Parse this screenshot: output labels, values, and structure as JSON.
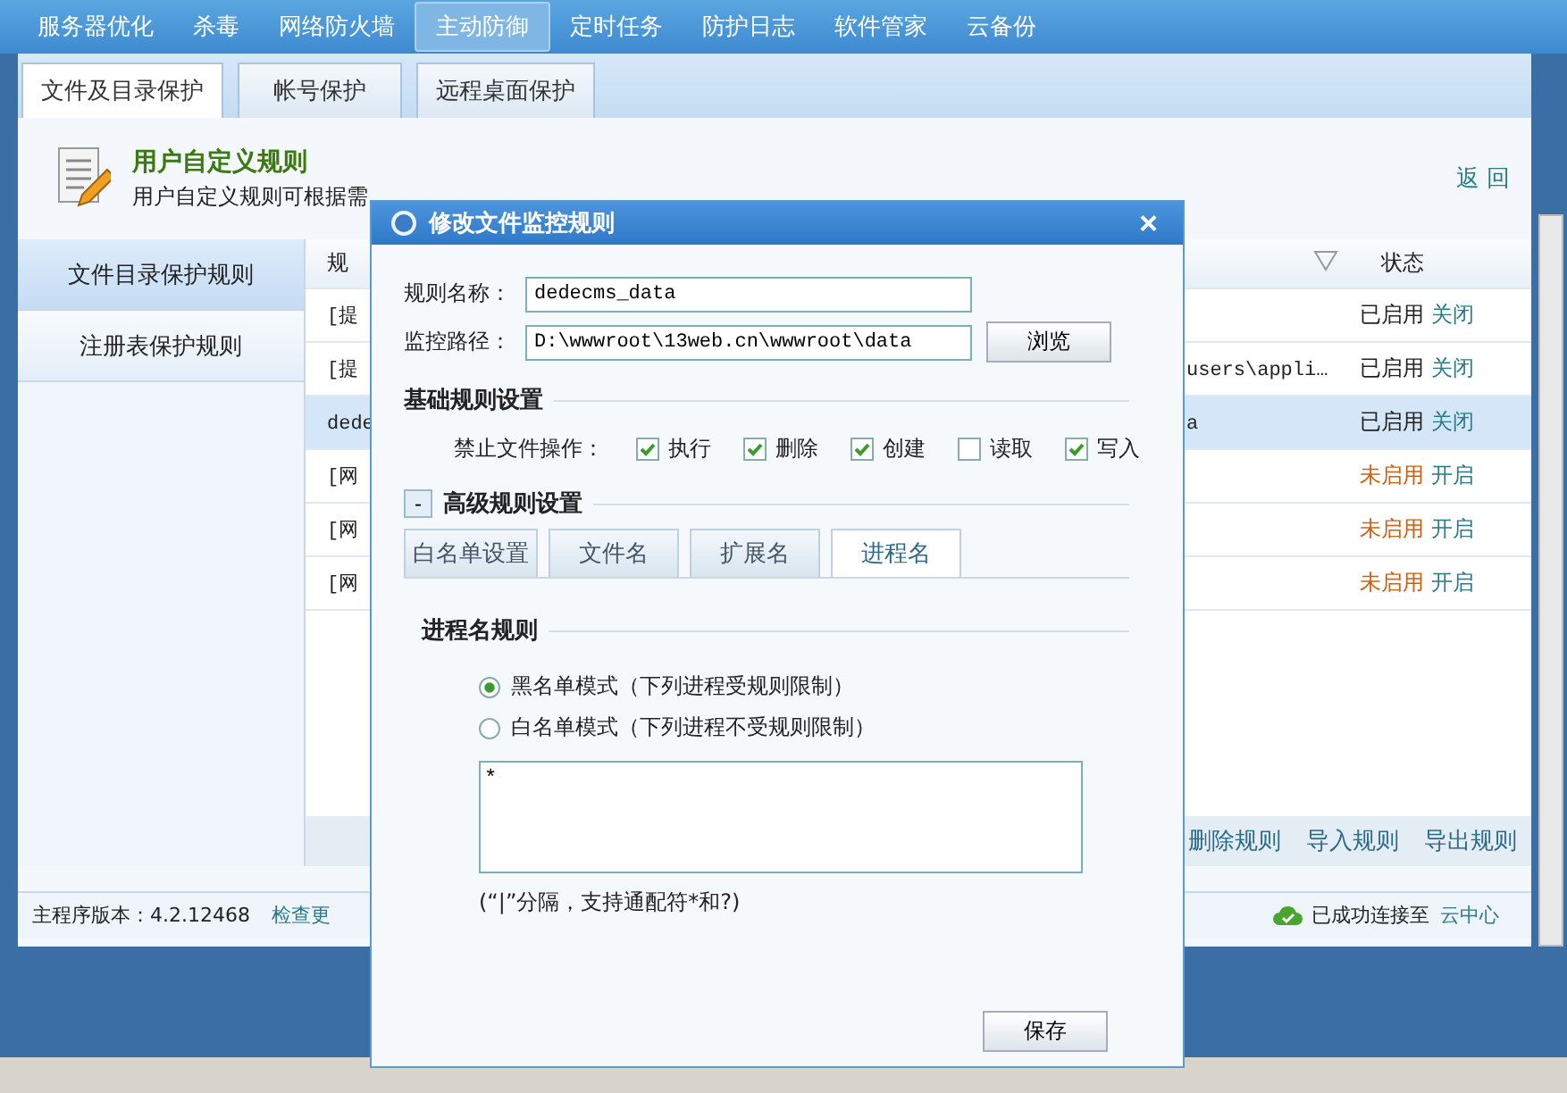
{
  "nav": [
    {
      "label": "服务器优化",
      "selected": false
    },
    {
      "label": "杀毒",
      "selected": false
    },
    {
      "label": "网络防火墙",
      "selected": false
    },
    {
      "label": "主动防御",
      "selected": true
    },
    {
      "label": "定时任务",
      "selected": false
    },
    {
      "label": "防护日志",
      "selected": false
    },
    {
      "label": "软件管家",
      "selected": false
    },
    {
      "label": "云备份",
      "selected": false
    }
  ],
  "subtabs": [
    {
      "label": "文件及目录保护",
      "selected": true
    },
    {
      "label": "帐号保护",
      "selected": false
    },
    {
      "label": "远程桌面保护",
      "selected": false
    }
  ],
  "header": {
    "title": "用户自定义规则",
    "description": "用户自定义规则可根据需",
    "back": "返 回"
  },
  "sidebar": [
    {
      "label": "文件目录保护规则",
      "selected": true
    },
    {
      "label": "注册表保护规则",
      "selected": false
    }
  ],
  "table": {
    "columns": [
      "规",
      "状态"
    ],
    "rows": [
      {
        "column_1": "[提",
        "column_2": "",
        "status": "已启用",
        "enabled": true,
        "action": "关闭",
        "selected": false
      },
      {
        "column_1": "[提",
        "column_2": "users\\appli…",
        "status": "已启用",
        "enabled": true,
        "action": "关闭",
        "selected": false
      },
      {
        "column_1": "dede",
        "column_2": "a",
        "status": "已启用",
        "enabled": true,
        "action": "关闭",
        "selected": true
      },
      {
        "column_1": "[网",
        "column_2": "",
        "status": "未启用",
        "enabled": false,
        "action": "开启",
        "selected": false
      },
      {
        "column_1": "[网",
        "column_2": "",
        "status": "未启用",
        "enabled": false,
        "action": "开启",
        "selected": false
      },
      {
        "column_1": "[网",
        "column_2": "",
        "status": "未启用",
        "enabled": false,
        "action": "开启",
        "selected": false
      }
    ]
  },
  "toolbar": [
    "删除规则",
    "导入规则",
    "导出规则"
  ],
  "status_bar": {
    "version": "主程序版本：4.2.12468",
    "update": "检查更",
    "connected": "已成功连接至",
    "cloud": "云中心"
  },
  "dialog": {
    "title": "修改文件监控规则",
    "close": "×",
    "fields": [
      {
        "label": "规则名称：",
        "value": "dedecms_data"
      },
      {
        "label": "监控路径：",
        "value": "D:\\wwwroot\\13web.cn\\wwwroot\\data"
      }
    ],
    "browse": "浏览",
    "basic_title": "基础规则设置",
    "ops_label": "禁止文件操作：",
    "ops": [
      {
        "label": "执行",
        "checked": true
      },
      {
        "label": "删除",
        "checked": true
      },
      {
        "label": "创建",
        "checked": true
      },
      {
        "label": "读取",
        "checked": false
      },
      {
        "label": "写入",
        "checked": true
      }
    ],
    "advanced": {
      "toggle": "-",
      "title": "高级规则设置",
      "expanded": true
    },
    "tabs": [
      {
        "label": "白名单设置",
        "selected": false
      },
      {
        "label": "文件名",
        "selected": false
      },
      {
        "label": "扩展名",
        "selected": false
      },
      {
        "label": "进程名",
        "selected": true
      }
    ],
    "process_title": "进程名规则",
    "modes": [
      {
        "label": "黑名单模式（下列进程受规则限制）",
        "selected": true
      },
      {
        "label": "白名单模式（下列进程不受规则限制）",
        "selected": false
      }
    ],
    "list_value": "*",
    "hint": "(“|”分隔，支持通配符*和?)",
    "save": "保存"
  }
}
